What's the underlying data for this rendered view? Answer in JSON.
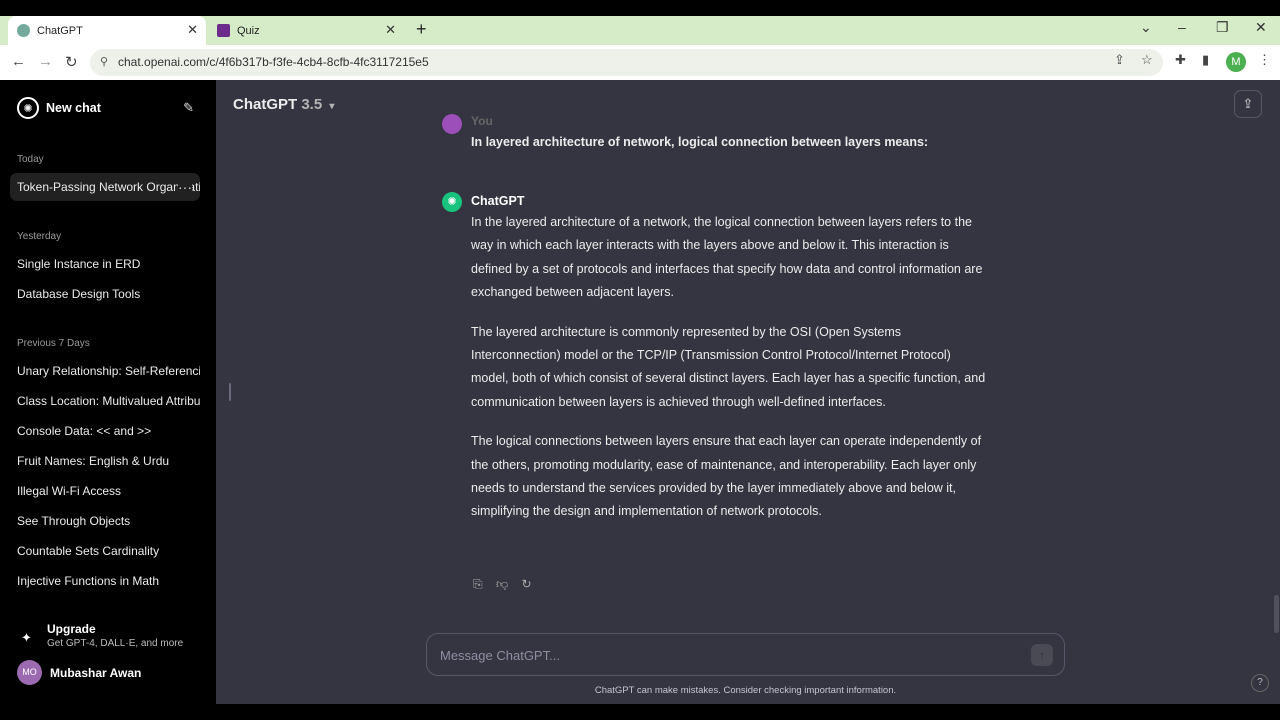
{
  "browser": {
    "tabs": [
      {
        "label": "ChatGPT",
        "active": true
      },
      {
        "label": "Quiz",
        "active": false
      }
    ],
    "url": "chat.openai.com/c/4f6b317b-f3fe-4cb4-8cfb-4fc3117215e5",
    "profile_initial": "M"
  },
  "sidebar": {
    "new_chat_label": "New chat",
    "sections": [
      {
        "title": "Today",
        "items": [
          "Token-Passing Network Organization"
        ]
      },
      {
        "title": "Yesterday",
        "items": [
          "Single Instance in ERD",
          "Database Design Tools"
        ]
      },
      {
        "title": "Previous 7 Days",
        "items": [
          "Unary Relationship: Self-Referencing",
          "Class Location: Multivalued Attribute",
          "Console Data: << and >>",
          "Fruit Names: English & Urdu",
          "Illegal Wi-Fi Access",
          "See Through Objects",
          "Countable Sets Cardinality",
          "Injective Functions in Math"
        ]
      }
    ],
    "upgrade": {
      "title": "Upgrade",
      "subtitle": "Get GPT-4, DALL·E, and more"
    },
    "user": {
      "initials": "MO",
      "name": "Mubashar Awan"
    }
  },
  "main": {
    "model_name": "ChatGPT",
    "model_version": "3.5",
    "user_label": "You",
    "question": "In layered architecture of network, logical connection between layers means:",
    "assistant_label": "ChatGPT",
    "answer": [
      "In the layered architecture of a network, the logical connection between layers refers to the way in which each layer interacts with the layers above and below it. This interaction is defined by a set of protocols and interfaces that specify how data and control information are exchanged between adjacent layers.",
      "The layered architecture is commonly represented by the OSI (Open Systems Interconnection) model or the TCP/IP (Transmission Control Protocol/Internet Protocol) model, both of which consist of several distinct layers. Each layer has a specific function, and communication between layers is achieved through well-defined interfaces.",
      "The logical connections between layers ensure that each layer can operate independently of the others, promoting modularity, ease of maintenance, and interoperability. Each layer only needs to understand the services provided by the layer immediately above and below it, simplifying the design and implementation of network protocols."
    ],
    "input_placeholder": "Message ChatGPT...",
    "disclaimer": "ChatGPT can make mistakes. Consider checking important information.",
    "help": "?"
  }
}
